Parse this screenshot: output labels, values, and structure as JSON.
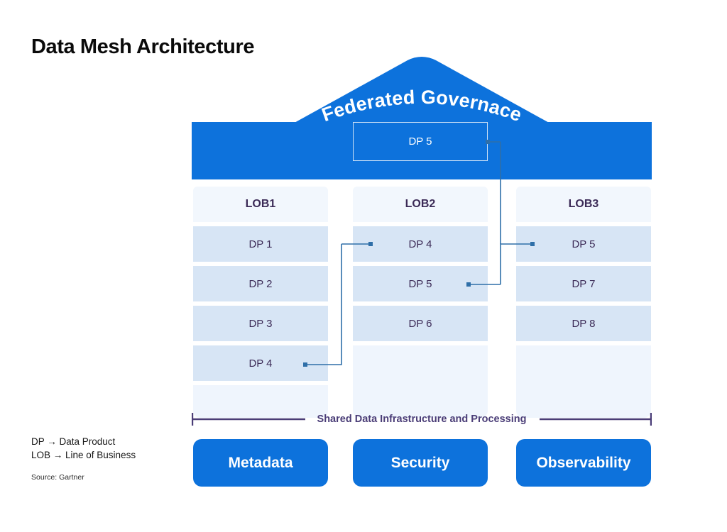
{
  "title": "Data Mesh Architecture",
  "roof": {
    "label": "Federated Governace",
    "product": "DP 5"
  },
  "columns": [
    {
      "header": "LOB1",
      "products": [
        "DP 1",
        "DP 2",
        "DP 3",
        "DP 4"
      ]
    },
    {
      "header": "LOB2",
      "products": [
        "DP 4",
        "DP 5",
        "DP 6"
      ]
    },
    {
      "header": "LOB3",
      "products": [
        "DP 5",
        "DP 7",
        "DP 8"
      ]
    }
  ],
  "shared": {
    "label": "Shared Data Infrastructure and Processing"
  },
  "pillars": [
    {
      "label": "Metadata"
    },
    {
      "label": "Security"
    },
    {
      "label": "Observability"
    }
  ],
  "legend": {
    "dp": "DP → Data Product",
    "lob": "LOB → Line of Business",
    "source": "Source: Gartner"
  },
  "colors": {
    "brand_blue": "#0d72dc",
    "row_blue": "#d7e5f5",
    "header_blue": "#f2f7fd",
    "filler_blue": "#eff5fd",
    "text_purple": "#3b2a56",
    "bracket_purple": "#4a3d77",
    "wire_blue": "#2f6fa8"
  }
}
